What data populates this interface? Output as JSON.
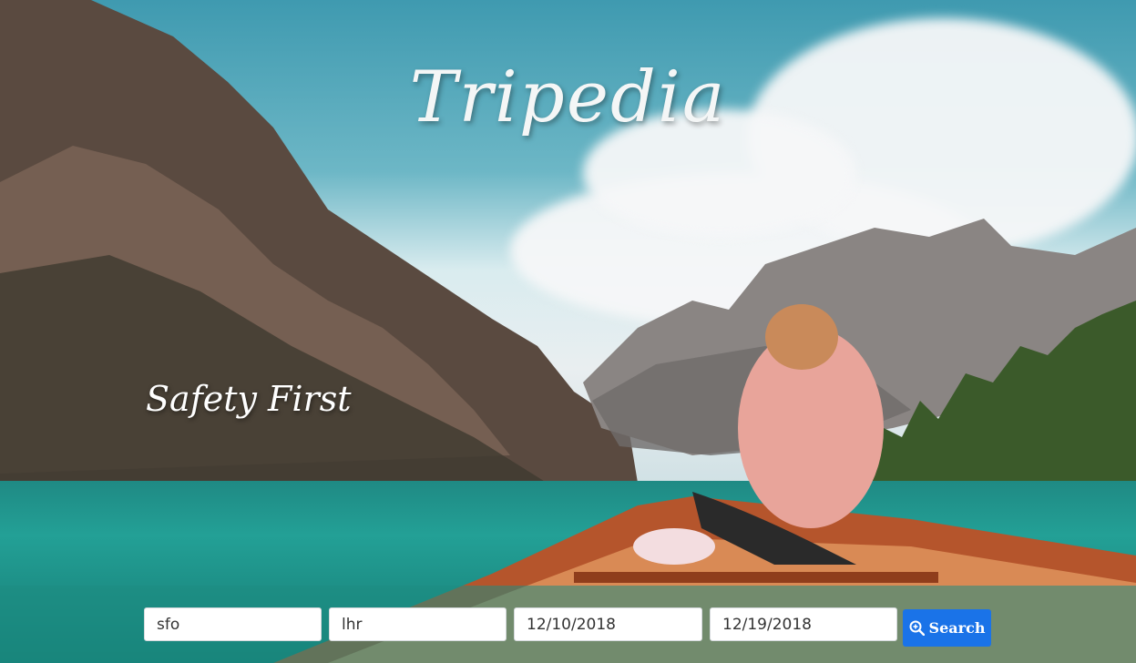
{
  "site": {
    "title": "Tripedia",
    "tagline": "Safety First"
  },
  "search": {
    "origin_value": "sfo",
    "destination_value": "lhr",
    "depart_value": "12/10/2018",
    "return_value": "12/19/2018",
    "button_label": "Search",
    "button_icon": "search-plus-icon",
    "accent_color": "#1a73e8"
  }
}
